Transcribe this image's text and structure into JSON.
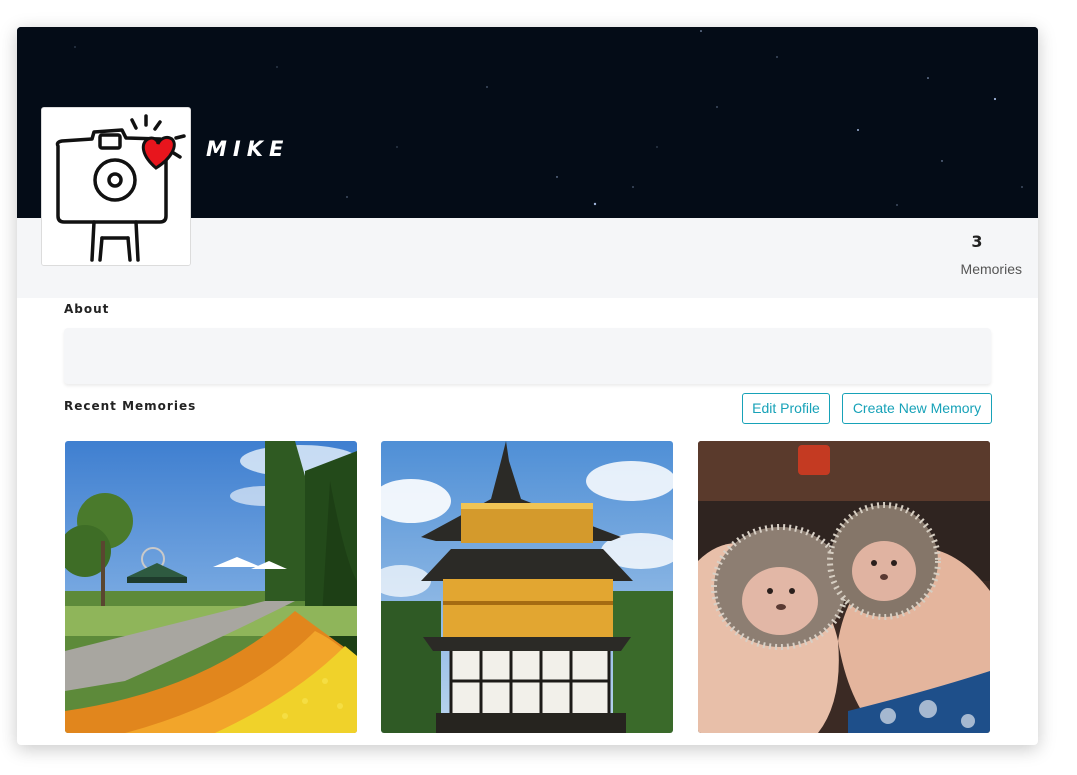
{
  "profile": {
    "name": "MIKE",
    "avatar_icon": "camera-heart-icon"
  },
  "stats": {
    "memories_count": "3",
    "memories_label": "Memories"
  },
  "about": {
    "title": "About",
    "text": ""
  },
  "recent": {
    "title": "Recent Memories"
  },
  "actions": {
    "edit_profile": "Edit Profile",
    "create_memory": "Create New Memory"
  },
  "memories": [
    {
      "image": "flower-garden-image"
    },
    {
      "image": "golden-pavilion-image"
    },
    {
      "image": "hedgehogs-image"
    }
  ],
  "colors": {
    "accent": "#17a2b8",
    "cover": "#040c17",
    "band": "#f5f6f8"
  }
}
